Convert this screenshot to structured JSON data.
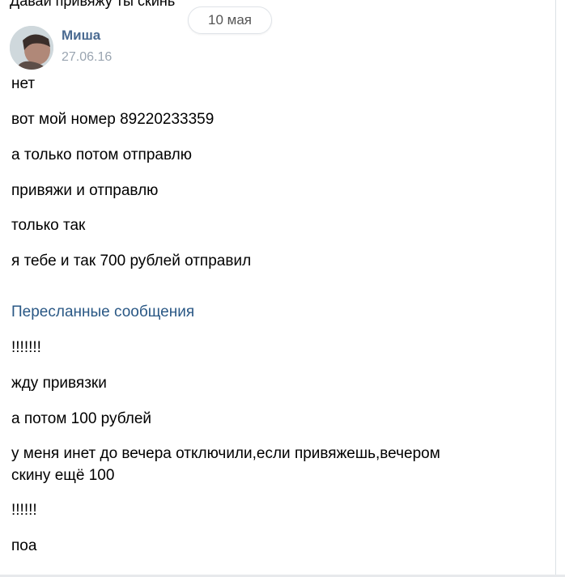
{
  "top_message": "Давай привяжу ты скинь",
  "date_label": "10 мая",
  "author": {
    "name": "Миша",
    "timestamp": "27.06.16"
  },
  "messages": [
    "нет",
    "вот мой номер 89220233359",
    "а только потом отправлю",
    "привяжи и отправлю",
    "только так",
    "я тебе и так 700 рублей отправил"
  ],
  "forwarded": {
    "header": "Пересланные сообщения",
    "messages": [
      "!!!!!!!",
      "жду привязки",
      "а потом 100 рублей",
      "у меня инет до вечера отключили,если привяжешь,вечером",
      "скину ещё 100",
      "!!!!!!",
      "поа"
    ]
  }
}
